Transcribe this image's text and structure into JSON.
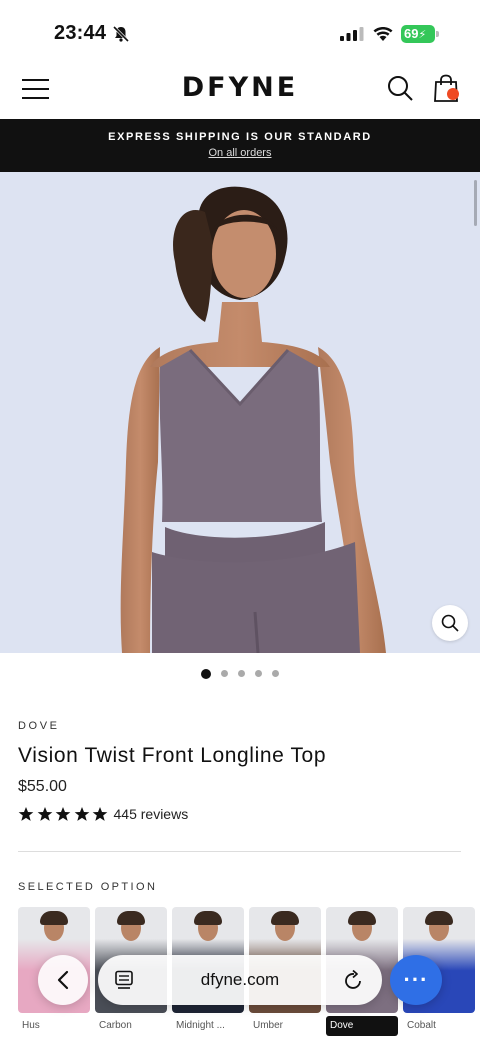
{
  "status": {
    "time": "23:44",
    "battery": "69"
  },
  "header": {
    "logo": "DFYNE"
  },
  "announcement": {
    "title": "EXPRESS SHIPPING IS OUR STANDARD",
    "link": "On all orders"
  },
  "carousel": {
    "total": 5,
    "active": 0
  },
  "product": {
    "color": "DOVE",
    "title": "Vision Twist Front Longline Top",
    "price": "$55.00",
    "rating_stars": 5,
    "reviews": "445 reviews"
  },
  "options": {
    "label": "SELECTED OPTION",
    "swatches": [
      {
        "name": "Hus",
        "color": "#e7a8c2"
      },
      {
        "name": "Carbon",
        "color": "#4a4e57"
      },
      {
        "name": "Midnight ...",
        "color": "#1e2535"
      },
      {
        "name": "Umber",
        "color": "#6a4b3a"
      },
      {
        "name": "Dove",
        "color": "#7d6f80"
      },
      {
        "name": "Cobalt",
        "color": "#2947b8"
      }
    ],
    "selected_index": 4
  },
  "browser": {
    "url": "dfyne.com"
  },
  "colors": {
    "hero_bg": "#dde3f2",
    "garment": "#7a6c7d",
    "browser_accent": "#2f6fe6",
    "cart_badge": "#ef4a23"
  }
}
